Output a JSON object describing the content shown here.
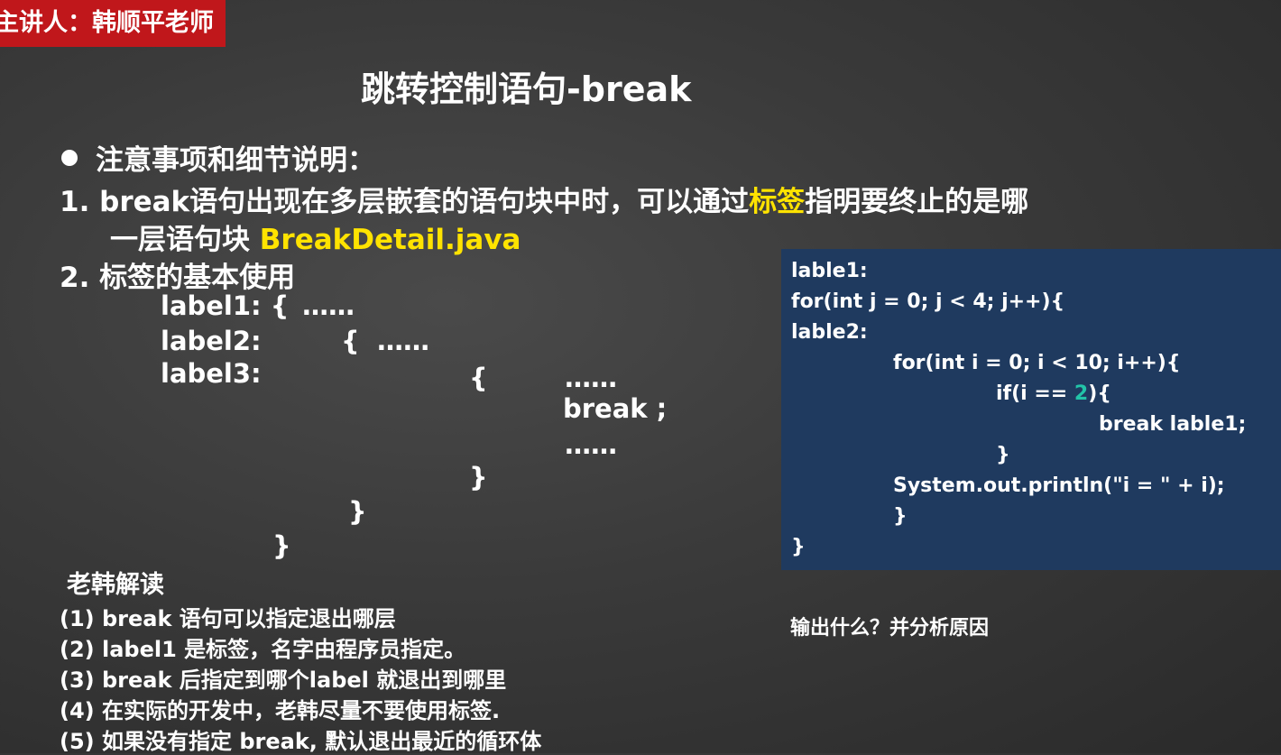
{
  "header": {
    "speaker": "主讲人：韩顺平老师",
    "title": "跳转控制语句-break"
  },
  "notes": {
    "heading": "注意事项和细节说明：",
    "point1_prefix": "1.  break语句出现在多层嵌套的语句块中时，可以通过",
    "point1_highlight": "标签",
    "point1_suffix": "指明要终止的是哪",
    "point1_line2_prefix": "一层语句块 ",
    "point1_line2_highlight": "BreakDetail.java",
    "point2": "2. 标签的基本使用"
  },
  "label_syntax": {
    "label1": "label1: {",
    "dots1": "……",
    "label2": "label2:",
    "brace2": "{",
    "dots2": "……",
    "label3": "label3:",
    "brace3": "{",
    "dots3": "……",
    "break_stmt": "break ;",
    "dots4": "……",
    "close3": "}",
    "close2": "}",
    "close1": "}"
  },
  "code": {
    "l1": "lable1:",
    "l2": "for(int j = 0; j < 4; j++){",
    "l3": "lable2:",
    "l4": "for(int i = 0; i < 10; i++){",
    "l5_prefix": "if(i == ",
    "l5_num": "2",
    "l5_suffix": "){",
    "l6": "break lable1;",
    "l7": "}",
    "l8": "System.out.println(\"i = \" + i);",
    "l9": "}",
    "l10": "}",
    "colors": {
      "background": "#1f3a5f",
      "highlight": "#22c4a8"
    }
  },
  "question": "输出什么？并分析原因",
  "commentary": {
    "title": "老韩解读",
    "items": [
      "(1) break 语句可以指定退出哪层",
      "(2) label1 是标签，名字由程序员指定。",
      "(3) break 后指定到哪个label 就退出到哪里",
      "(4) 在实际的开发中，老韩尽量不要使用标签.",
      "(5) 如果没有指定 break, 默认退出最近的循环体"
    ]
  },
  "colors": {
    "badge": "#c0171b",
    "accent_yellow": "#ffe300"
  }
}
